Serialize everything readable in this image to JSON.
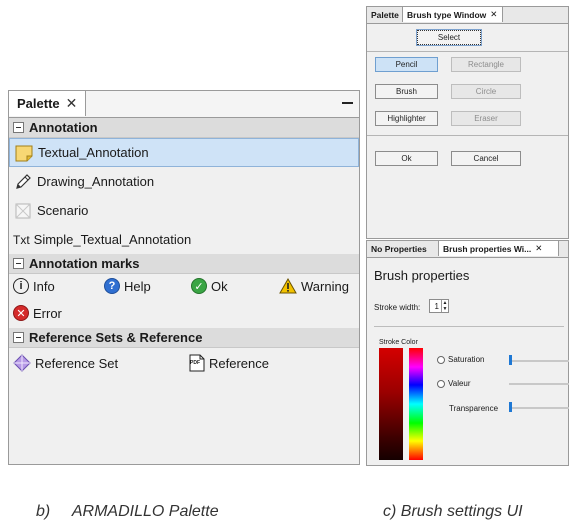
{
  "palette": {
    "tab_label": "Palette",
    "close_glyph": "✕",
    "sections": {
      "annotation": {
        "title": "Annotation",
        "items": [
          {
            "label": "Textual_Annotation",
            "icon": "sticky-note-icon",
            "selected": true
          },
          {
            "label": "Drawing_Annotation",
            "icon": "pencil-icon"
          },
          {
            "label": "Scenario",
            "icon": "scenario-icon"
          },
          {
            "label": "Simple_Textual_Annotation",
            "icon": "txt-icon",
            "icon_text": "Txt"
          }
        ]
      },
      "annotation_marks": {
        "title": "Annotation marks",
        "items": [
          {
            "label": "Info",
            "icon": "info-icon",
            "glyph": "i"
          },
          {
            "label": "Help",
            "icon": "help-icon",
            "glyph": "?"
          },
          {
            "label": "Ok",
            "icon": "ok-check-icon",
            "glyph": "✓"
          },
          {
            "label": "Warning",
            "icon": "warning-triangle-icon",
            "glyph": "!"
          },
          {
            "label": "Error",
            "icon": "error-x-icon",
            "glyph": "✕"
          }
        ]
      },
      "reference": {
        "title": "Reference Sets & Reference",
        "items": [
          {
            "label": "Reference Set",
            "icon": "reference-set-icon"
          },
          {
            "label": "Reference",
            "icon": "pdf-document-icon",
            "icon_text": "PDF"
          }
        ]
      }
    }
  },
  "brush_type_window": {
    "tab_inactive": "Palette",
    "tab_active": "Brush type Window",
    "close_glyph": "✕",
    "select_label": "Select",
    "buttons": {
      "pencil": "Pencil",
      "rectangle": "Rectangle",
      "brush": "Brush",
      "circle": "Circle",
      "highlighter": "Highlighter",
      "eraser": "Eraser"
    },
    "ok_label": "Ok",
    "cancel_label": "Cancel"
  },
  "brush_properties": {
    "tab_inactive": "No Properties",
    "tab_active": "Brush properties Wi...",
    "close_glyph": "✕",
    "title": "Brush properties",
    "stroke_width_label": "Stroke width:",
    "stroke_width_value": "1",
    "stroke_color_label": "Stroke Color",
    "saturation_label": "Saturation",
    "valeur_label": "Valeur",
    "transparence_label": "Transparence"
  },
  "captions": {
    "palette": "b)     ARMADILLO Palette",
    "brush": "c) Brush settings UI"
  },
  "colors": {
    "selection": "#cfe3f7",
    "info_blue": "#1f5fbf",
    "ok_green": "#2e9e3a",
    "warning_yellow": "#f2c200",
    "error_red": "#d42a2a"
  }
}
